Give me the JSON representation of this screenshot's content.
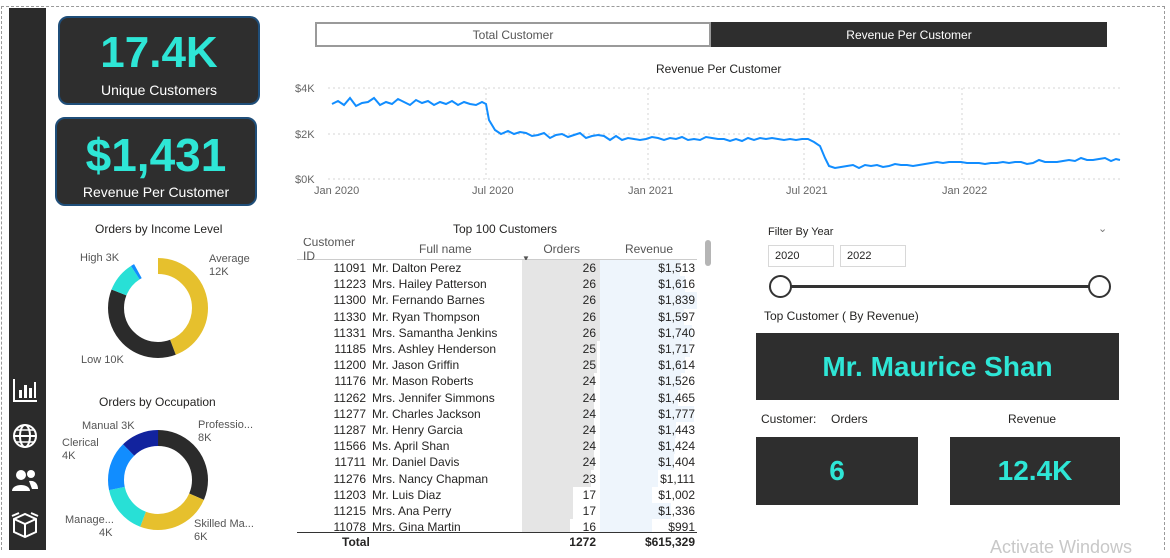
{
  "kpis": {
    "unique_customers": {
      "value": "17.4K",
      "label": "Unique Customers"
    },
    "revenue_per_customer": {
      "value": "$1,431",
      "label": "Revenue Per Customer"
    }
  },
  "tabs": [
    {
      "label": "Total Customer",
      "selected": false
    },
    {
      "label": "Revenue Per Customer",
      "selected": true
    }
  ],
  "nav_icons": [
    "bar-chart-icon",
    "globe-icon",
    "users-icon",
    "box-icon"
  ],
  "colors": {
    "accent": "#2ee6d6",
    "dark": "#2e2e2e",
    "line": "#118dff",
    "yellow": "#e6c02d",
    "navy": "#12239e"
  },
  "line_chart": {
    "title": "Revenue Per Customer",
    "y_ticks": [
      "$4K",
      "$2K",
      "$0K"
    ],
    "x_ticks": [
      "Jan 2020",
      "Jul 2020",
      "Jan 2021",
      "Jul 2021",
      "Jan 2022"
    ]
  },
  "income_chart": {
    "title": "Orders by Income Level",
    "labels": {
      "high": [
        "High 3K"
      ],
      "average": [
        "Average",
        "12K"
      ],
      "low": [
        "Low 10K"
      ]
    }
  },
  "occupation_chart": {
    "title": "Orders by Occupation",
    "labels": {
      "manual": [
        "Manual 3K"
      ],
      "professional": [
        "Professio...",
        "8K"
      ],
      "clerical": [
        "Clerical",
        "4K"
      ],
      "management": [
        "Manage...",
        "4K"
      ],
      "skilled": [
        "Skilled Ma...",
        "6K"
      ]
    }
  },
  "table": {
    "title": "Top 100 Customers",
    "columns": [
      "Customer ID",
      "Full name",
      "Orders",
      "Revenue"
    ],
    "rows": [
      {
        "id": "11091",
        "name": "Mr. Dalton Perez",
        "orders": "26",
        "revenue": "$1,513"
      },
      {
        "id": "11223",
        "name": "Mrs. Hailey Patterson",
        "orders": "26",
        "revenue": "$1,616"
      },
      {
        "id": "11300",
        "name": "Mr. Fernando Barnes",
        "orders": "26",
        "revenue": "$1,839"
      },
      {
        "id": "11330",
        "name": "Mr. Ryan Thompson",
        "orders": "26",
        "revenue": "$1,597"
      },
      {
        "id": "11331",
        "name": "Mrs. Samantha Jenkins",
        "orders": "26",
        "revenue": "$1,740"
      },
      {
        "id": "11185",
        "name": "Mrs. Ashley Henderson",
        "orders": "25",
        "revenue": "$1,717"
      },
      {
        "id": "11200",
        "name": "Mr. Jason Griffin",
        "orders": "25",
        "revenue": "$1,614"
      },
      {
        "id": "11176",
        "name": "Mr. Mason Roberts",
        "orders": "24",
        "revenue": "$1,526"
      },
      {
        "id": "11262",
        "name": "Mrs. Jennifer Simmons",
        "orders": "24",
        "revenue": "$1,465"
      },
      {
        "id": "11277",
        "name": "Mr. Charles Jackson",
        "orders": "24",
        "revenue": "$1,777"
      },
      {
        "id": "11287",
        "name": "Mr. Henry Garcia",
        "orders": "24",
        "revenue": "$1,443"
      },
      {
        "id": "11566",
        "name": "Ms. April Shan",
        "orders": "24",
        "revenue": "$1,424"
      },
      {
        "id": "11711",
        "name": "Mr. Daniel Davis",
        "orders": "24",
        "revenue": "$1,404"
      },
      {
        "id": "11276",
        "name": "Mrs. Nancy Chapman",
        "orders": "23",
        "revenue": "$1,111"
      },
      {
        "id": "11203",
        "name": "Mr. Luis Diaz",
        "orders": "17",
        "revenue": "$1,002"
      },
      {
        "id": "11215",
        "name": "Mrs. Ana Perry",
        "orders": "17",
        "revenue": "$1,336"
      },
      {
        "id": "11078",
        "name": "Mrs. Gina Martin",
        "orders": "16",
        "revenue": "$991"
      }
    ],
    "total": {
      "label": "Total",
      "orders": "1272",
      "revenue": "$615,329"
    }
  },
  "slicer": {
    "title": "Filter By Year",
    "from": "2020",
    "to": "2022",
    "range": [
      2020,
      2022
    ]
  },
  "top_customer": {
    "title": "Top Customer ( By Revenue)",
    "name": "Mr. Maurice Shan",
    "customer_label": "Customer:",
    "orders_label": "Orders",
    "revenue_label": "Revenue",
    "orders": "6",
    "revenue": "12.4K"
  },
  "watermark": "Activate Windows"
}
